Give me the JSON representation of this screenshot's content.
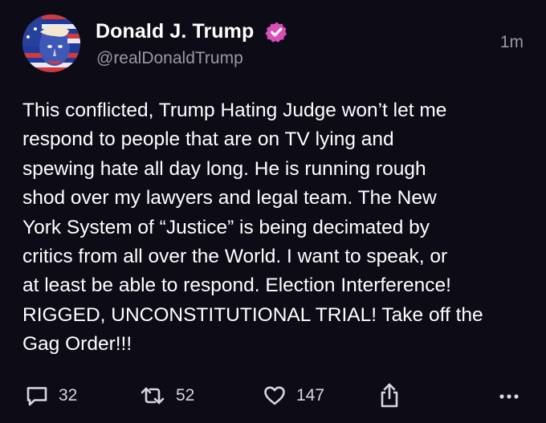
{
  "post": {
    "author": {
      "display_name": "Donald J. Trump",
      "handle": "@realDonaldTrump",
      "verified": true,
      "verified_color": "#d94eb7"
    },
    "timestamp": "1m",
    "text": "This conflicted, Trump Hating Judge won’t let me\nrespond to people that are on TV lying and\nspewing hate all day long. He is running rough\nshod over my lawyers and legal team. The New\nYork System of “Justice” is being decimated by\ncritics from all over the World. I want to speak, or\nat least be able to respond. Election Interference!\nRIGGED, UNCONSTITUTIONAL TRIAL! Take off the\nGag Order!!!",
    "actions": {
      "replies": "32",
      "reposts": "52",
      "likes": "147",
      "icons": [
        "reply-icon",
        "repost-icon",
        "heart-icon",
        "share-icon",
        "more-icon"
      ]
    }
  },
  "colors": {
    "background": "#0c0b16",
    "text": "#ffffff",
    "secondary_text": "#9a98a6"
  }
}
